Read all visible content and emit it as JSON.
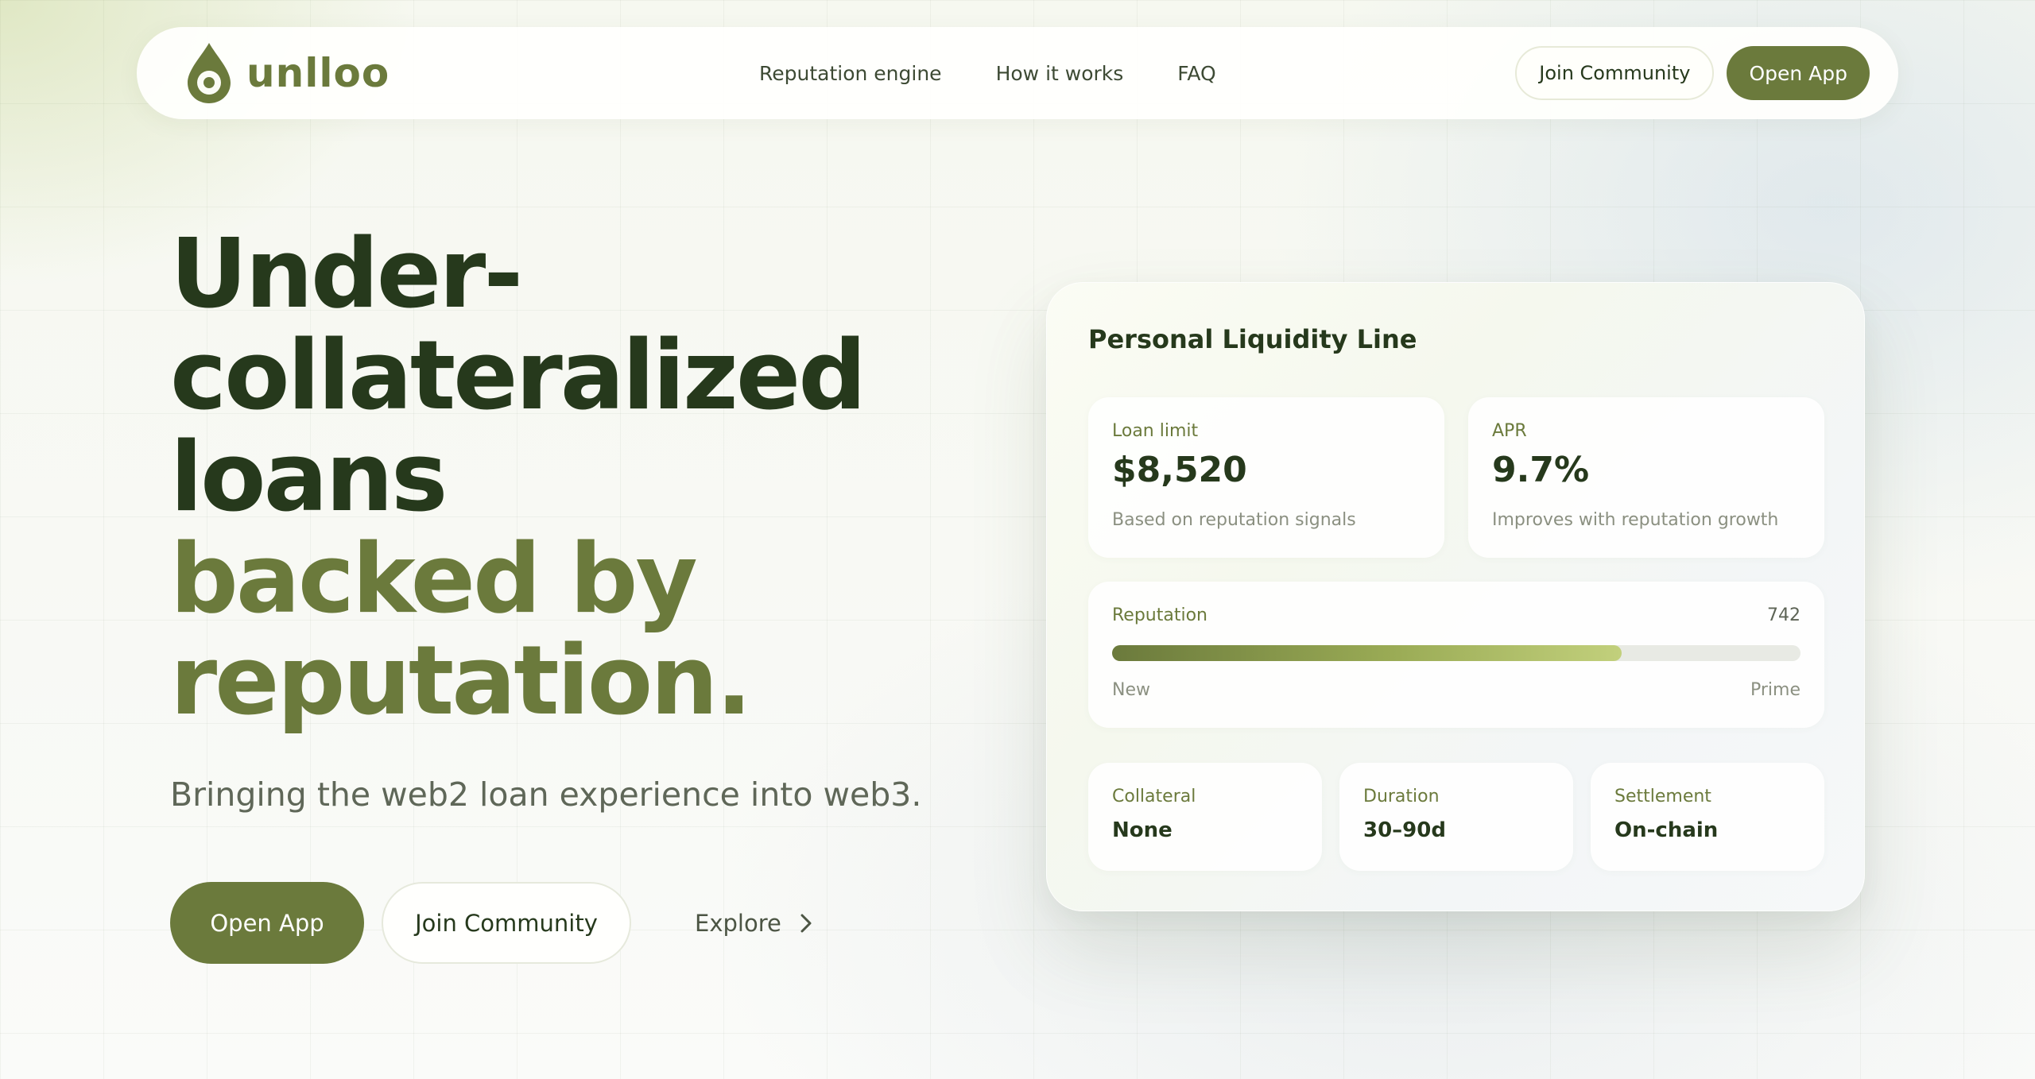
{
  "brand": {
    "name": "unlloo",
    "color": "#6b7a3c"
  },
  "nav": {
    "links": [
      "Reputation engine",
      "How it works",
      "FAQ"
    ],
    "join_label": "Join Community",
    "open_label": "Open App"
  },
  "hero": {
    "title_dark": [
      "Under-",
      "collateralized",
      "loans"
    ],
    "title_accent": [
      "backed by",
      "reputation."
    ],
    "subtitle": "Bringing the web2 loan experience into web3.",
    "cta_primary": "Open App",
    "cta_secondary": "Join Community",
    "cta_explore": "Explore"
  },
  "card": {
    "title": "Personal Liquidity Line",
    "loan_limit": {
      "label": "Loan limit",
      "value": "$8,520",
      "note": "Based on reputation signals"
    },
    "apr": {
      "label": "APR",
      "value": "9.7%",
      "note": "Improves with reputation growth"
    },
    "reputation": {
      "label": "Reputation",
      "score": "742",
      "min_label": "New",
      "max_label": "Prime",
      "progress": 0.74
    },
    "stats": [
      {
        "label": "Collateral",
        "value": "None"
      },
      {
        "label": "Duration",
        "value": "30–90d"
      },
      {
        "label": "Settlement",
        "value": "On-chain"
      }
    ]
  }
}
